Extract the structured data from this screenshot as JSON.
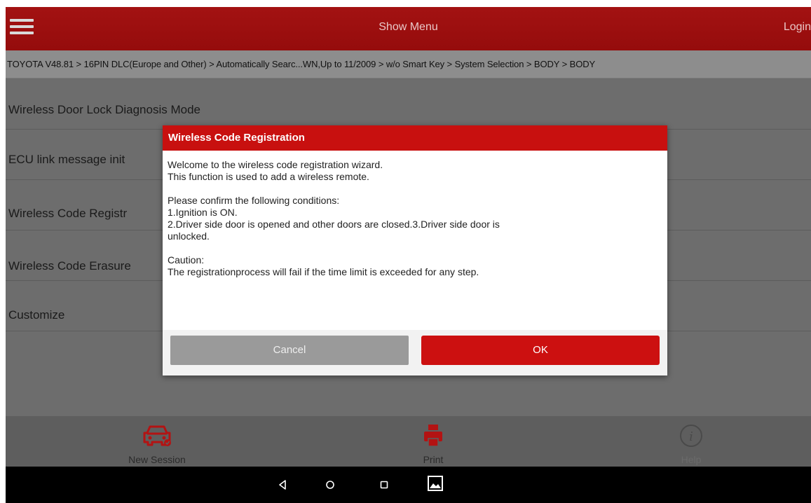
{
  "colors": {
    "brand_red": "#c8100f",
    "titlebar_red": "#9e0f0f",
    "overlay_gray": "#6d6d6d",
    "cancel_gray": "#9a9a9a"
  },
  "header": {
    "title": "Show Menu",
    "login_label": "Login",
    "menu_icon": "hamburger-menu-icon"
  },
  "breadcrumb": "TOYOTA V48.81 > 16PIN DLC(Europe and Other) > Automatically Searc...WN,Up to 11/2009 > w/o Smart Key > System Selection > BODY > BODY",
  "menu_items": [
    "Wireless Door Lock Diagnosis Mode",
    "ECU link message init",
    "Wireless Code Registr",
    "Wireless Code Erasure",
    "Customize"
  ],
  "dialog": {
    "title": "Wireless Code Registration",
    "line1": "Welcome to the wireless code registration wizard.",
    "line2": "This function is used to add a wireless remote.",
    "line3": "Please confirm the following conditions:",
    "line4": "1.Ignition is ON.",
    "line5": "2.Driver side door is opened and other doors are closed.3.Driver side door is",
    "line6": "unlocked.",
    "line7": "Caution:",
    "line8": "The registrationprocess will fail if the time limit is exceeded for any step.",
    "cancel_label": "Cancel",
    "ok_label": "OK"
  },
  "toolbar": {
    "new_session": "New Session",
    "print": "Print",
    "help": "Help"
  },
  "navbar": {
    "back_icon": "back-triangle-icon",
    "home_icon": "home-circle-icon",
    "recents_icon": "recents-square-icon",
    "screenshot_icon": "gallery-icon"
  }
}
